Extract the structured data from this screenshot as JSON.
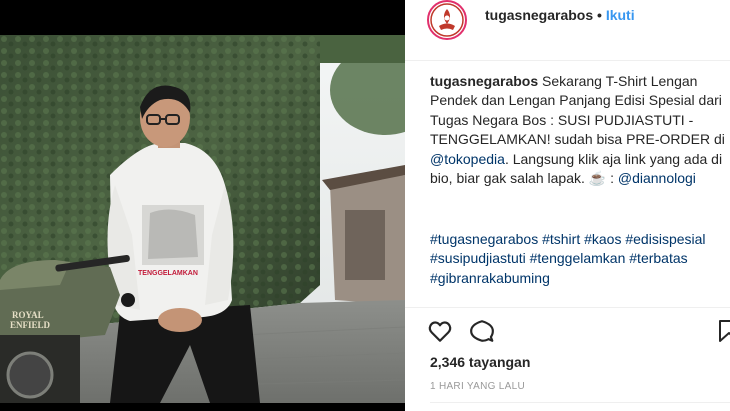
{
  "post": {
    "username": "tugasnegarabos",
    "separator": "•",
    "follow_label": "Ikuti",
    "caption": {
      "username": "tugasnegarabos",
      "text_1": " Sekarang T-Shirt Lengan Pendek dan Lengan Panjang Edisi Spesial dari Tugas Negara Bos : SUSI PUDJIASTUTI - TENGGELAMKAN! sudah bisa PRE-ORDER di ",
      "mention_1": "@tokopedia",
      "text_2": ". Langsung klik aja link yang ada di bio, biar gak salah lapak. ☕ : ",
      "mention_2": "@diannologi"
    },
    "hashtags": [
      "#tugasnegarabos",
      "#tshirt",
      "#kaos",
      "#edisispesial",
      "#susipudjiastuti",
      "#tenggelamkan",
      "#terbatas",
      "#gibranrakabuming"
    ],
    "views": "2,346 tayangan",
    "time": "1 HARI YANG LALU"
  },
  "photo": {
    "shirt_print": "TENGGELAMKAN",
    "motorcycle_brand_line1": "ROYAL",
    "motorcycle_brand_line2": "ENFIELD"
  },
  "icons": {
    "like": "heart-outline-icon",
    "comment": "comment-bubble-icon",
    "save": "bookmark-icon"
  },
  "colors": {
    "follow": "#3897f0",
    "link": "#003569",
    "muted": "#999999"
  }
}
